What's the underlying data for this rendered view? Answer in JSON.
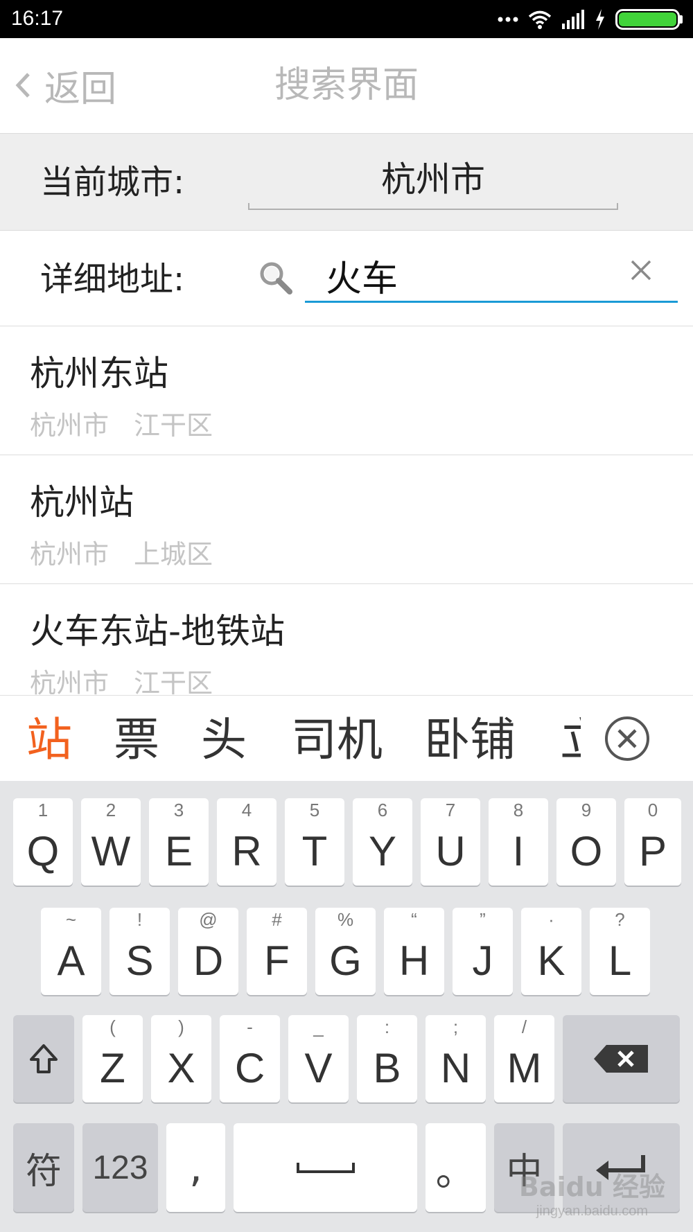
{
  "status_bar": {
    "time": "16:17",
    "icons": [
      "more-dots-icon",
      "wifi-icon",
      "signal-icon",
      "charging-icon",
      "battery-icon"
    ]
  },
  "header": {
    "back_label": "返回",
    "title": "搜索界面"
  },
  "city": {
    "label": "当前城市:",
    "value": "杭州市"
  },
  "address": {
    "label": "详细地址:",
    "value": "火车"
  },
  "results": [
    {
      "name": "杭州东站",
      "city": "杭州市",
      "district": "江干区"
    },
    {
      "name": "杭州站",
      "city": "杭州市",
      "district": "上城区"
    },
    {
      "name": "火车东站-地铁站",
      "city": "杭州市",
      "district": "江干区"
    }
  ],
  "candidates": [
    "站",
    "票",
    "头",
    "司机",
    "卧铺",
    "立"
  ],
  "keyboard": {
    "row1": [
      {
        "hint": "1",
        "key": "Q"
      },
      {
        "hint": "2",
        "key": "W"
      },
      {
        "hint": "3",
        "key": "E"
      },
      {
        "hint": "4",
        "key": "R"
      },
      {
        "hint": "5",
        "key": "T"
      },
      {
        "hint": "6",
        "key": "Y"
      },
      {
        "hint": "7",
        "key": "U"
      },
      {
        "hint": "8",
        "key": "I"
      },
      {
        "hint": "9",
        "key": "O"
      },
      {
        "hint": "0",
        "key": "P"
      }
    ],
    "row2": [
      {
        "hint": "~",
        "key": "A"
      },
      {
        "hint": "!",
        "key": "S"
      },
      {
        "hint": "@",
        "key": "D"
      },
      {
        "hint": "#",
        "key": "F"
      },
      {
        "hint": "%",
        "key": "G"
      },
      {
        "hint": "“",
        "key": "H"
      },
      {
        "hint": "”",
        "key": "J"
      },
      {
        "hint": "·",
        "key": "K"
      },
      {
        "hint": "?",
        "key": "L"
      }
    ],
    "row3": [
      {
        "hint": "(",
        "key": "Z"
      },
      {
        "hint": ")",
        "key": "X"
      },
      {
        "hint": "-",
        "key": "C"
      },
      {
        "hint": "_",
        "key": "V"
      },
      {
        "hint": ":",
        "key": "B"
      },
      {
        "hint": ";",
        "key": "N"
      },
      {
        "hint": "/",
        "key": "M"
      }
    ],
    "symbol_label": "符",
    "numbers_label": "123",
    "comma_label": ",",
    "period_label": "。",
    "lang_label": "中",
    "shift_icon": "shift-icon",
    "backspace_icon": "backspace-icon",
    "space_icon": "space-icon",
    "enter_icon": "enter-icon"
  },
  "watermark": {
    "logo": "Baidu 经验",
    "url": "jingyan.baidu.com"
  },
  "colors": {
    "accent": "#1a9ad6",
    "candidate_active": "#f2611e",
    "muted_text": "#b8b8b8"
  }
}
